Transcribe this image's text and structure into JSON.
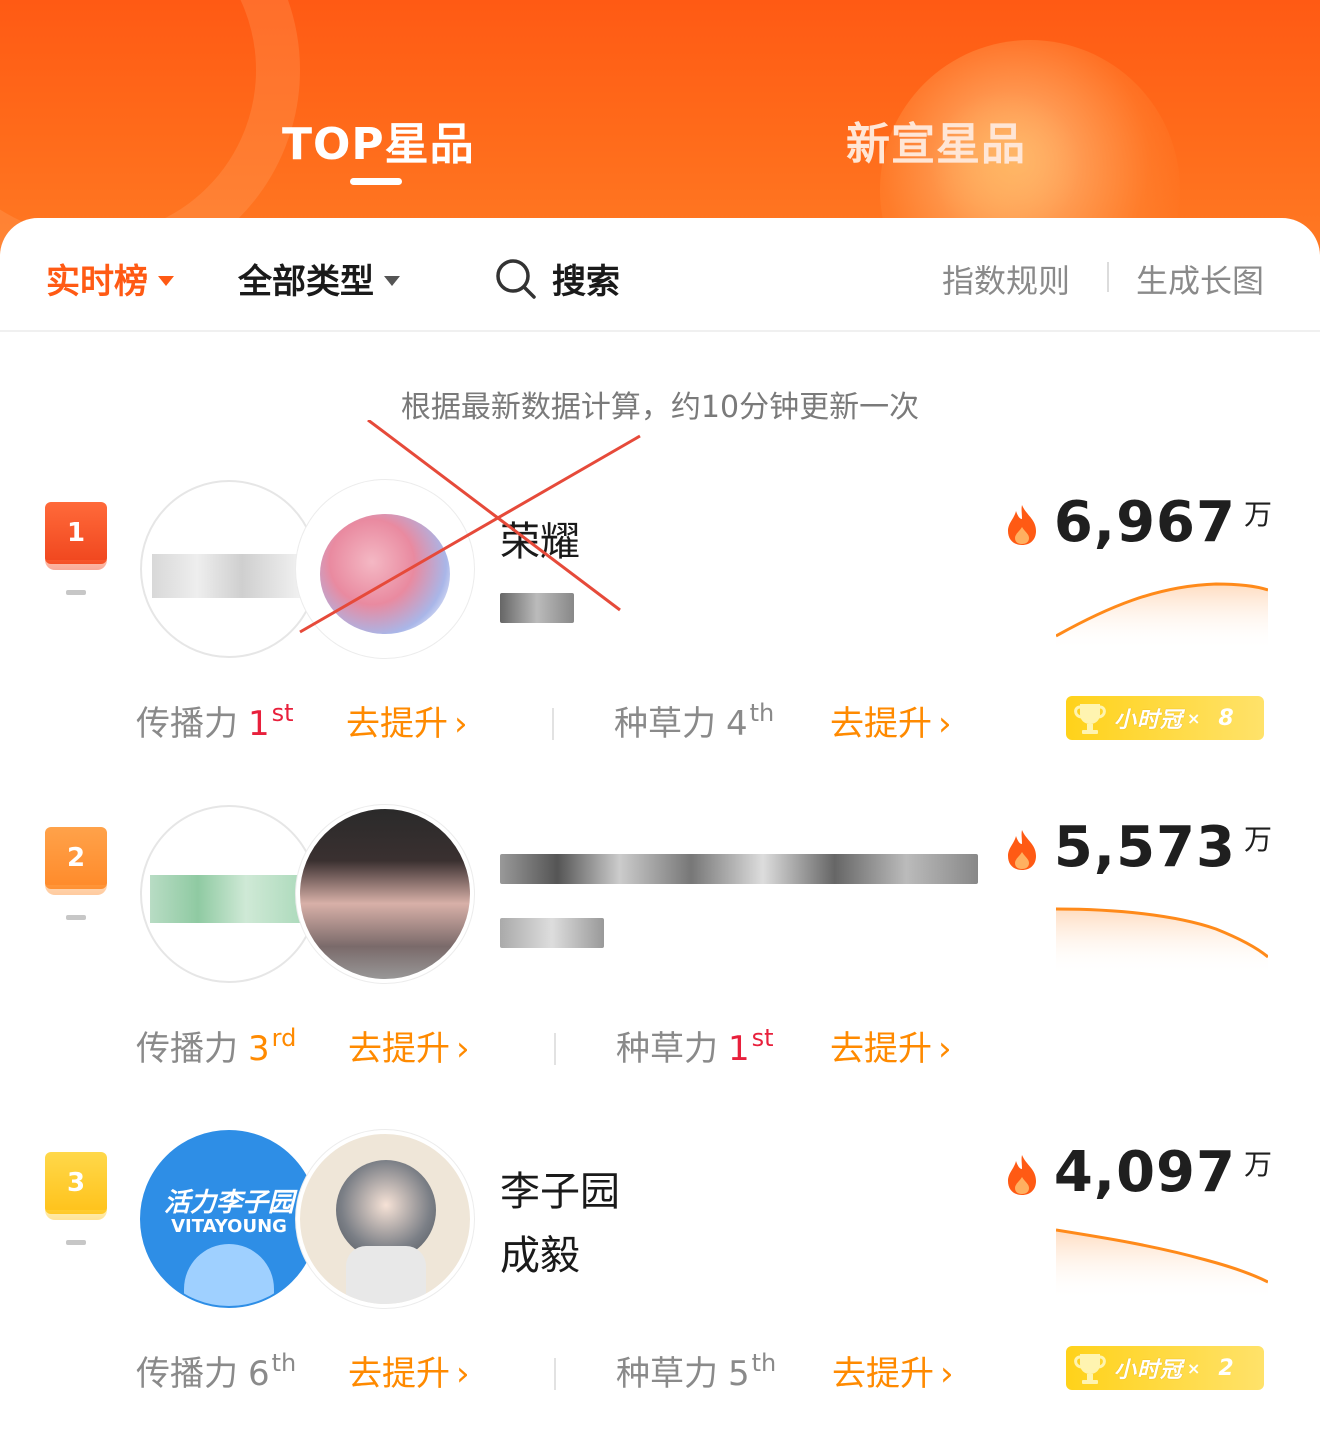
{
  "tabs": {
    "top": "TOP星品",
    "new": "新宣星品"
  },
  "filter": {
    "realtime": "实时榜",
    "type": "全部类型",
    "search": "搜索",
    "rule": "指数规则",
    "long_image": "生成长图"
  },
  "notice": "根据最新数据计算，约10分钟更新一次",
  "rows": [
    {
      "rank": "1",
      "name_line1": "荣耀",
      "name_line2": "",
      "score": "6,967",
      "unit": "万",
      "spread_label": "传播力",
      "spread_rank": "1",
      "spread_suffix": "st",
      "seed_label": "种草力",
      "seed_rank": "4",
      "seed_suffix": "th",
      "action": "去提升",
      "crown_label": "小时冠",
      "crown_x": "×",
      "crown_count": "8"
    },
    {
      "rank": "2",
      "name_line1": "",
      "name_line2": "",
      "score": "5,573",
      "unit": "万",
      "spread_label": "传播力",
      "spread_rank": "3",
      "spread_suffix": "rd",
      "seed_label": "种草力",
      "seed_rank": "1",
      "seed_suffix": "st",
      "action": "去提升"
    },
    {
      "rank": "3",
      "name_line1": "李子园",
      "name_line2": "成毅",
      "avatar_logo_line1": "活力李子园",
      "avatar_logo_line2": "VITAYOUNG",
      "score": "4,097",
      "unit": "万",
      "spread_label": "传播力",
      "spread_rank": "6",
      "spread_suffix": "th",
      "seed_label": "种草力",
      "seed_rank": "5",
      "seed_suffix": "th",
      "action": "去提升",
      "crown_label": "小时冠",
      "crown_x": "×",
      "crown_count": "2"
    }
  ],
  "colors": {
    "brand": "#ff5a14",
    "accent": "#ff8a00",
    "rank_first": "#e8203c"
  },
  "icons": {
    "search": "search-icon",
    "flame": "flame-icon",
    "trophy": "trophy-icon",
    "caret": "caret-down-icon",
    "chevron": "chevron-right-icon"
  }
}
